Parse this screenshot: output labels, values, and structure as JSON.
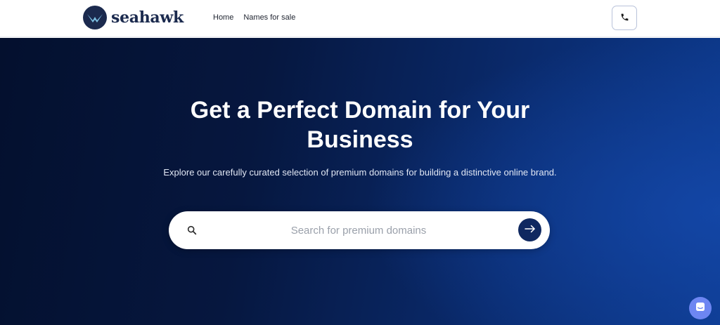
{
  "header": {
    "logo_text": "seahawk",
    "nav": [
      {
        "label": "Home"
      },
      {
        "label": "Names for sale"
      }
    ],
    "phone_icon": "phone-icon"
  },
  "hero": {
    "title": "Get a Perfect Domain for Your Business",
    "subtitle": "Explore our carefully curated selection of premium domains for building a distinctive online brand.",
    "search": {
      "placeholder": "Search for premium domains",
      "value": "",
      "search_icon": "search-icon",
      "submit_icon": "arrow-right-icon"
    }
  },
  "chat_widget": {
    "icon": "chat-icon"
  },
  "colors": {
    "brand_navy": "#1b2a4e",
    "hero_dark": "#04102e",
    "hero_blue": "#0d3a8e",
    "search_button": "#0f2860",
    "chat_bubble": "#6d86f2"
  }
}
